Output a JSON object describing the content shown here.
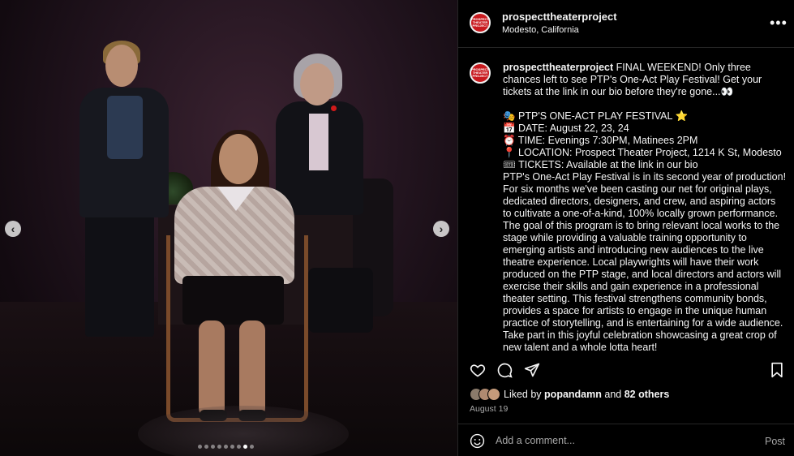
{
  "post": {
    "username": "prospecttheaterproject",
    "location": "Modesto, California",
    "avatar_text": "PROSPECT THEATER PROJECT",
    "more_label": "•••"
  },
  "media": {
    "prev_label": "‹",
    "next_label": "›",
    "dots_total": 9,
    "dots_active_index": 7
  },
  "caption": {
    "username": "prospecttheaterproject",
    "text": " FINAL WEEKEND! Only three chances left to see PTP's One-Act Play Festival! Get your tickets at the link in our bio before they're gone...👀\n\n🎭 PTP'S ONE-ACT PLAY FESTIVAL ⭐\n📅 DATE: August 22, 23, 24\n⏰ TIME: Evenings 7:30PM, Matinees 2PM\n📍 LOCATION: Prospect Theater Project, 1214 K St, Modesto\n🎟 TICKETS: Available at the link in our bio\nPTP's One-Act Play Festival is in its second year of production! For six months we've been casting our net for original plays, dedicated directors, designers, and crew, and aspiring actors to cultivate a one-of-a-kind, 100% locally grown performance. The goal of this program is to bring relevant local works to the stage while providing a valuable training opportunity to emerging artists and introducing new audiences to the live theatre experience. Local playwrights will have their work produced on the PTP stage, and local directors and actors will exercise their skills and gain experience in a professional theater setting. This festival strengthens community bonds, provides a space for artists to engage in the unique human practice of storytelling, and is entertaining for a wide audience. Take part in this joyful celebration showcasing a great crop of new talent and a whole lotta heart!"
  },
  "likes": {
    "prefix": "Liked by",
    "user": "popandamn",
    "middle": "and",
    "others": "82 others",
    "face_colors": [
      "#8a7a6a",
      "#b08a70",
      "#c49a7a"
    ]
  },
  "date": "August 19",
  "comment": {
    "placeholder": "Add a comment...",
    "post_label": "Post"
  },
  "icons": [
    "heart-icon",
    "comment-icon",
    "share-icon",
    "bookmark-icon",
    "emoji-icon",
    "more-icon",
    "chevron-left-icon",
    "chevron-right-icon"
  ],
  "colors": {
    "background": "#000000",
    "text": "#f5f5f5",
    "muted": "#a8a8a8",
    "border": "#262626",
    "brand": "#c8191e"
  }
}
